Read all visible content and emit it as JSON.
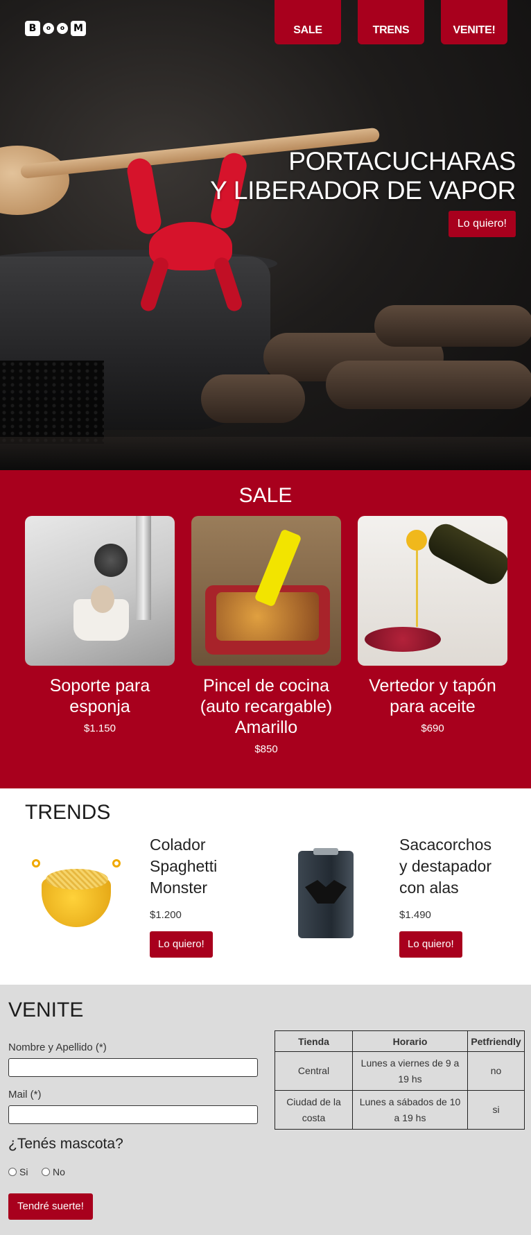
{
  "header": {
    "logo": {
      "letters": [
        "B",
        "o",
        "o",
        "M"
      ]
    },
    "nav": [
      {
        "label": "SALE"
      },
      {
        "label": "TRENS"
      },
      {
        "label": "VENITE!"
      }
    ]
  },
  "hero": {
    "title_line1": "PORTACUCHARAS",
    "title_line2": "Y LIBERADOR DE VAPOR",
    "cta": "Lo quiero!"
  },
  "sale": {
    "heading": "SALE",
    "items": [
      {
        "name": "Soporte para esponja",
        "price": "$1.150",
        "image": "sponge-holder-photo"
      },
      {
        "name": "Pincel de cocina (auto recargable) Amarillo",
        "price": "$850",
        "image": "cooking-brush-photo"
      },
      {
        "name": "Vertedor y tapón para aceite",
        "price": "$690",
        "image": "oil-pourer-photo"
      }
    ]
  },
  "trends": {
    "heading": "TRENDS",
    "items": [
      {
        "name": "Colador Spaghetti Monster",
        "price": "$1.200",
        "cta": "Lo quiero!",
        "image": "spaghetti-monster-colander-photo"
      },
      {
        "name": "Sacacorchos y destapador con alas",
        "price": "$1.490",
        "cta": "Lo quiero!",
        "image": "bat-corkscrew-photo"
      }
    ]
  },
  "venite": {
    "heading": "VENITE",
    "form": {
      "name_label": "Nombre y Apellido (*)",
      "name_value": "",
      "mail_label": "Mail (*)",
      "mail_value": "",
      "pet_question": "¿Tenés mascota?",
      "options": [
        "Si",
        "No"
      ],
      "submit": "Tendré suerte!"
    },
    "table": {
      "headers": [
        "Tienda",
        "Horario",
        "Petfriendly"
      ],
      "rows": [
        [
          "Central",
          "Lunes a viernes de 9 a 19 hs",
          "no"
        ],
        [
          "Ciudad de la costa",
          "Lunes a sábados de 10 a 19 hs",
          "si"
        ]
      ]
    }
  },
  "colors": {
    "brand_red": "#a8001d",
    "form_bg": "#dcdcdc"
  }
}
